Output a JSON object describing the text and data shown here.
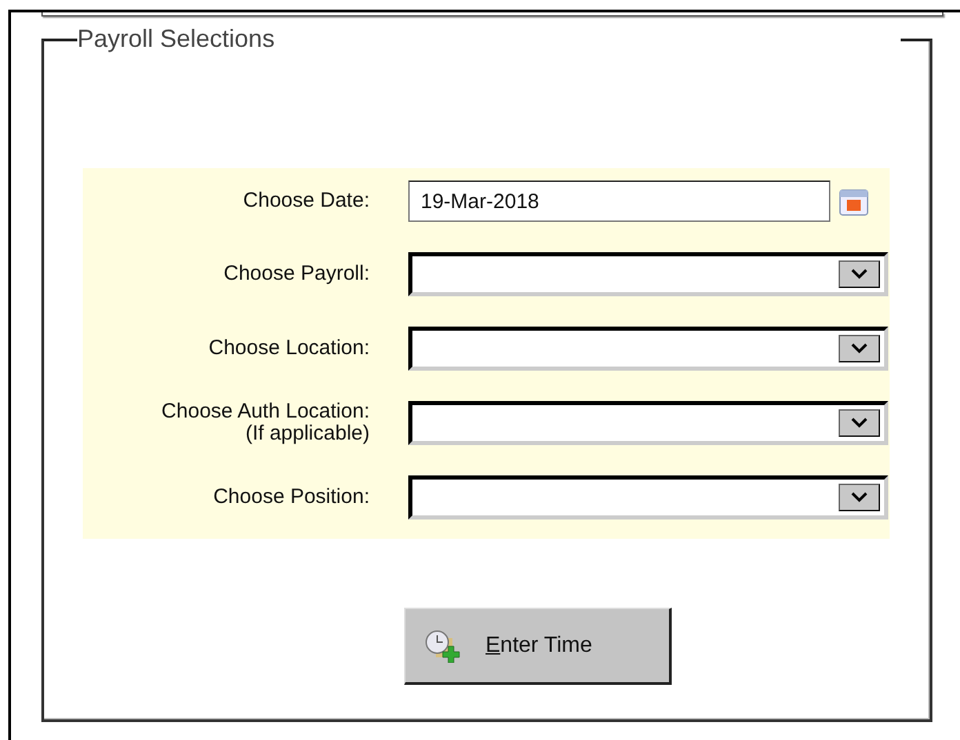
{
  "section": {
    "title": "Payroll Selections"
  },
  "fields": [
    {
      "kind": "date",
      "label": "Choose Date:",
      "value": "19-Mar-2018"
    },
    {
      "kind": "select",
      "label": "Choose Payroll:"
    },
    {
      "kind": "select",
      "label": "Choose Location:"
    },
    {
      "kind": "select",
      "label": "Choose Auth Location:",
      "note": "(If applicable)"
    },
    {
      "kind": "select",
      "label": "Choose Position:"
    }
  ],
  "button": {
    "label": "Enter Time"
  }
}
